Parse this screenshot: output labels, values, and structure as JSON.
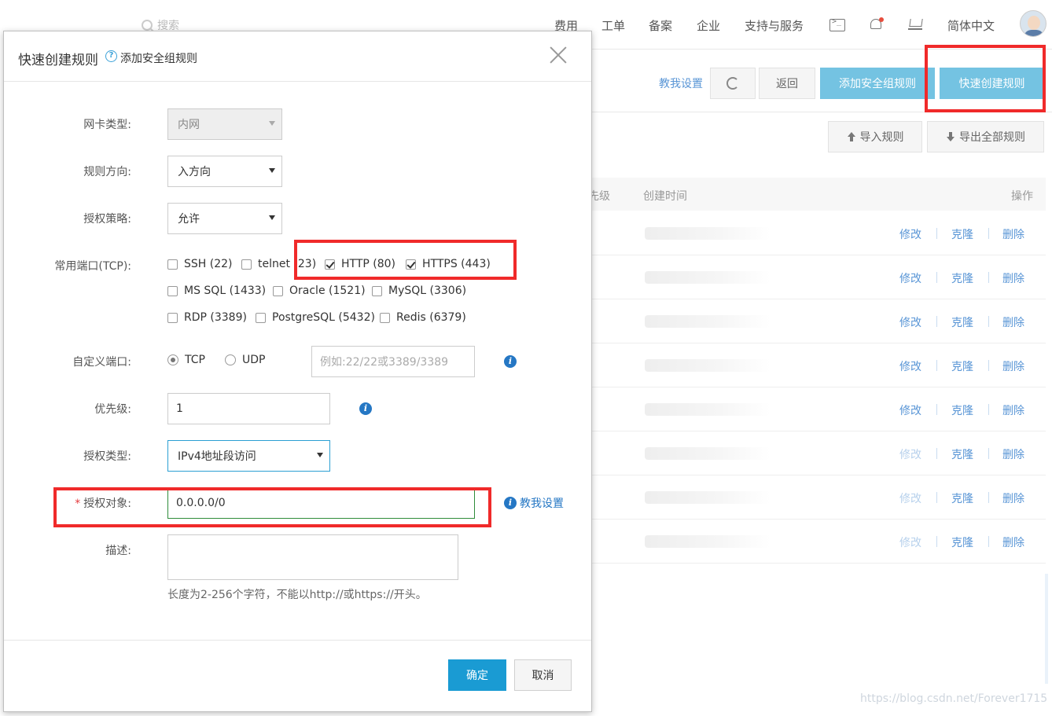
{
  "topbar": {
    "search_placeholder": "搜索",
    "nav": [
      "费用",
      "工单",
      "备案",
      "企业",
      "支持与服务"
    ],
    "language": "简体中文",
    "icons": [
      "terminal-icon",
      "bell-icon",
      "cart-icon",
      "avatar"
    ]
  },
  "toolbar": {
    "teach_link": "教我设置",
    "back_label": "返回",
    "add_rule_label": "添加安全组规则",
    "quick_create_label": "快速创建规则",
    "import_label": "导入规则",
    "export_label": "导出全部规则"
  },
  "table": {
    "headers": {
      "priority_partial": "先级",
      "created_time": "创建时间",
      "actions": "操作"
    },
    "actions": {
      "edit": "修改",
      "clone": "克隆",
      "delete": "删除"
    },
    "rows": [
      {
        "edit_enabled": true
      },
      {
        "edit_enabled": true
      },
      {
        "edit_enabled": true
      },
      {
        "edit_enabled": true
      },
      {
        "edit_enabled": true
      },
      {
        "edit_enabled": false
      },
      {
        "edit_enabled": false
      },
      {
        "edit_enabled": false
      }
    ]
  },
  "modal": {
    "title": "快速创建规则",
    "help_icon": "?",
    "subtitle": "添加安全组规则",
    "labels": {
      "nic_type": "网卡类型:",
      "direction": "规则方向:",
      "policy": "授权策略:",
      "common_ports": "常用端口(TCP):",
      "custom_port": "自定义端口:",
      "priority": "优先级:",
      "auth_type": "授权类型:",
      "auth_target": "授权对象:",
      "description": "描述:"
    },
    "required_mark": "*",
    "nic_type_value": "内网",
    "direction_value": "入方向",
    "policy_value": "允许",
    "ports": [
      {
        "label": "SSH (22)",
        "checked": false
      },
      {
        "label": "telnet (23)",
        "checked": false
      },
      {
        "label": "HTTP (80)",
        "checked": true
      },
      {
        "label": "HTTPS (443)",
        "checked": true
      },
      {
        "label": "MS SQL (1433)",
        "checked": false
      },
      {
        "label": "Oracle (1521)",
        "checked": false
      },
      {
        "label": "MySQL (3306)",
        "checked": false
      },
      {
        "label": "RDP (3389)",
        "checked": false
      },
      {
        "label": "PostgreSQL (5432)",
        "checked": false
      },
      {
        "label": "Redis (6379)",
        "checked": false
      }
    ],
    "protocols": [
      {
        "label": "TCP",
        "selected": true
      },
      {
        "label": "UDP",
        "selected": false
      }
    ],
    "custom_port_placeholder": "例如:22/22或3389/3389",
    "priority_value": "1",
    "auth_type_value": "IPv4地址段访问",
    "auth_target_value": "0.0.0.0/0",
    "teach_link": "教我设置",
    "description_value": "",
    "description_hint": "长度为2-256个字符，不能以http://或https://开头。",
    "ok_label": "确定",
    "cancel_label": "取消"
  },
  "watermark": "https://blog.csdn.net/Forever1715",
  "colors": {
    "primary": "#1a9bd3",
    "primary_light": "#74c3e2",
    "link": "#2577c4",
    "annotation": "#f02a2a"
  }
}
